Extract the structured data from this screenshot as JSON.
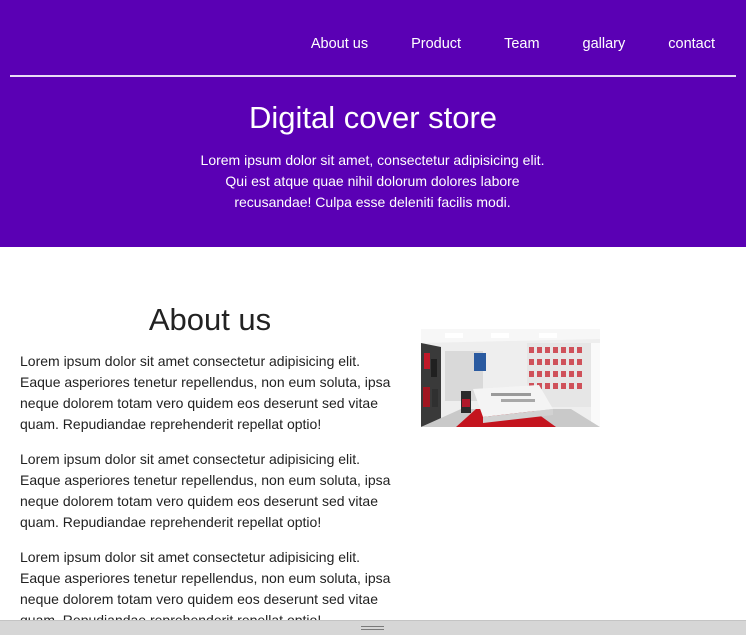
{
  "nav": {
    "items": [
      "About us",
      "Product",
      "Team",
      "gallary",
      "contact"
    ]
  },
  "hero": {
    "title": "Digital cover store",
    "text": "Lorem ipsum dolor sit amet, consectetur adipisicing elit. Qui est atque quae nihil dolorum dolores labore recusandae! Culpa esse deleniti facilis modi."
  },
  "about": {
    "title": "About us",
    "paragraphs": [
      "Lorem ipsum dolor sit amet consectetur adipisicing elit. Eaque asperiores tenetur repellendus, non eum soluta, ipsa neque dolorem totam vero quidem eos deserunt sed vitae quam. Repudiandae reprehenderit repellat optio!",
      "Lorem ipsum dolor sit amet consectetur adipisicing elit. Eaque asperiores tenetur repellendus, non eum soluta, ipsa neque dolorem totam vero quidem eos deserunt sed vitae quam. Repudiandae reprehenderit repellat optio!",
      "Lorem ipsum dolor sit amet consectetur adipisicing elit. Eaque asperiores tenetur repellendus, non eum soluta, ipsa neque dolorem totam vero quidem eos deserunt sed vitae quam. Repudiandae reprehenderit repellat optio!"
    ]
  },
  "colors": {
    "hero_background": "#5a00b4",
    "hero_text": "#ffffff",
    "body_text": "#222222"
  },
  "icons": {
    "scrollbar_grip": "grip-lines-icon"
  }
}
